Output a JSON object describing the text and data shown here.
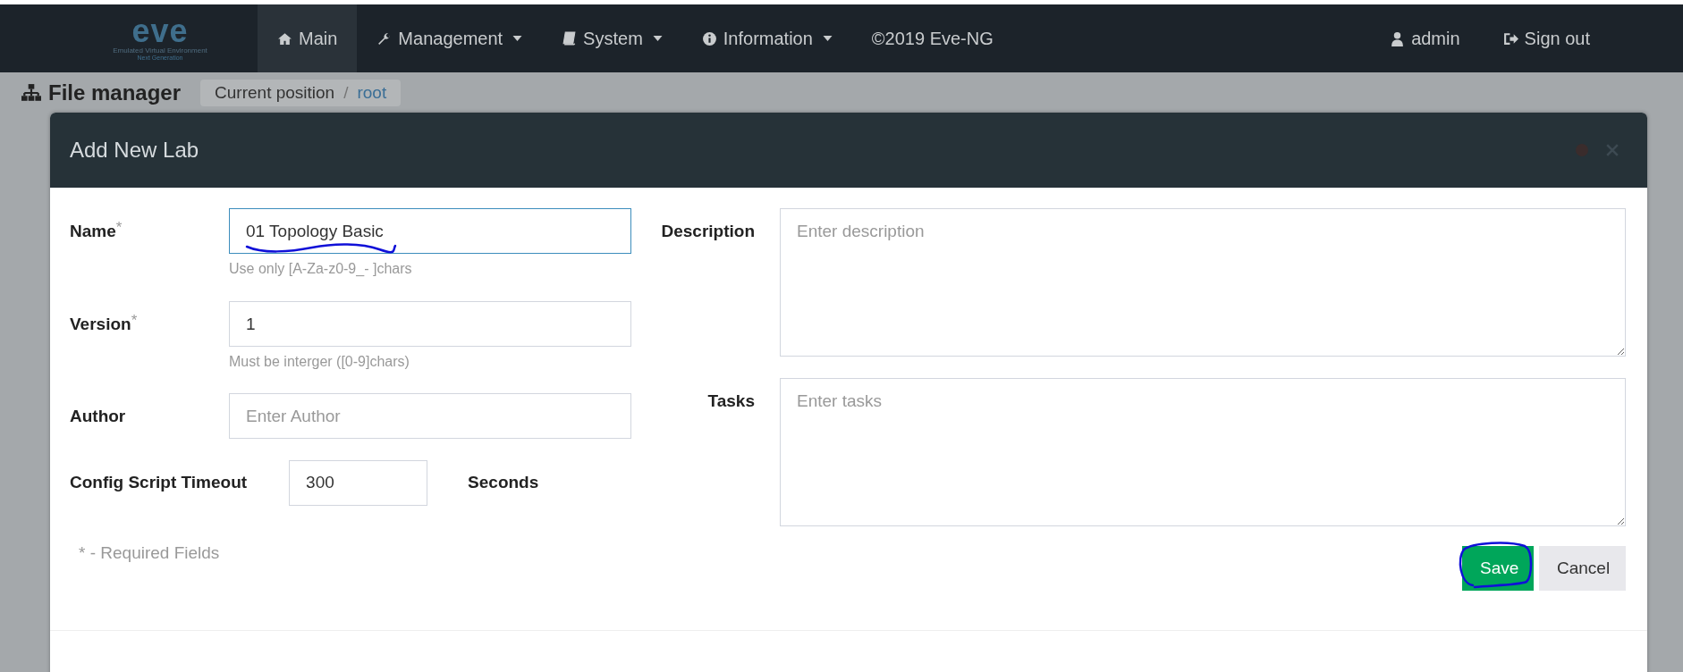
{
  "navbar": {
    "logo": {
      "mark": "eve",
      "line_1": "Emulated Virtual Environment",
      "line_2": "Next Generation"
    },
    "items": [
      {
        "label": "Main",
        "dropdown": false,
        "selected": true
      },
      {
        "label": "Management",
        "dropdown": true,
        "selected": false
      },
      {
        "label": "System",
        "dropdown": true,
        "selected": false
      },
      {
        "label": "Information",
        "dropdown": true,
        "selected": false
      },
      {
        "label": "©2019 Eve-NG",
        "dropdown": false,
        "selected": false
      }
    ],
    "right_items": [
      {
        "label": "admin"
      },
      {
        "label": "Sign out"
      }
    ]
  },
  "page": {
    "title": "File manager",
    "breadcrumb": {
      "label": "Current position",
      "separator": "/",
      "current": "root"
    }
  },
  "dialog": {
    "title": "Add New Lab",
    "required_mark": "*",
    "fields": [
      {
        "label": "Name",
        "required": true,
        "value": "01 Topology Basic",
        "hint": "Use only [A-Za-z0-9_- ]chars",
        "focused": true
      },
      {
        "label": "Version",
        "required": true,
        "value": "1",
        "hint": "Must be interger ([0-9]chars)",
        "focused": false
      },
      {
        "label": "Author",
        "required": false,
        "placeholder": "Enter Author",
        "focused": false
      }
    ],
    "timeout": {
      "label": "Config Script Timeout",
      "value": "300",
      "unit": "Seconds"
    },
    "required_note": "* - Required Fields",
    "textareas": [
      {
        "label": "Description",
        "placeholder": "Enter description"
      },
      {
        "label": "Tasks",
        "placeholder": "Enter tasks"
      }
    ],
    "buttons": [
      {
        "label": "Save",
        "kind": "primary"
      },
      {
        "label": "Cancel",
        "kind": "default"
      }
    ]
  }
}
